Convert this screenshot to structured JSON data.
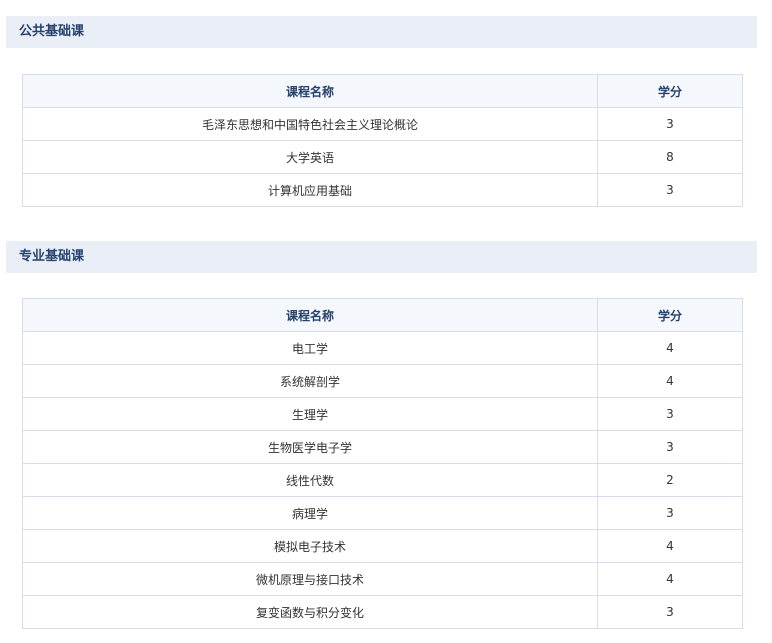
{
  "sections": [
    {
      "title": "公共基础课",
      "columns": [
        "课程名称",
        "学分"
      ],
      "rows": [
        [
          "毛泽东思想和中国特色社会主义理论概论",
          "3"
        ],
        [
          "大学英语",
          "8"
        ],
        [
          "计算机应用基础",
          "3"
        ]
      ]
    },
    {
      "title": "专业基础课",
      "columns": [
        "课程名称",
        "学分"
      ],
      "rows": [
        [
          "电工学",
          "4"
        ],
        [
          "系统解剖学",
          "4"
        ],
        [
          "生理学",
          "3"
        ],
        [
          "生物医学电子学",
          "3"
        ],
        [
          "线性代数",
          "2"
        ],
        [
          "病理学",
          "3"
        ],
        [
          "模拟电子技术",
          "4"
        ],
        [
          "微机原理与接口技术",
          "4"
        ],
        [
          "复变函数与积分变化",
          "3"
        ]
      ]
    }
  ]
}
